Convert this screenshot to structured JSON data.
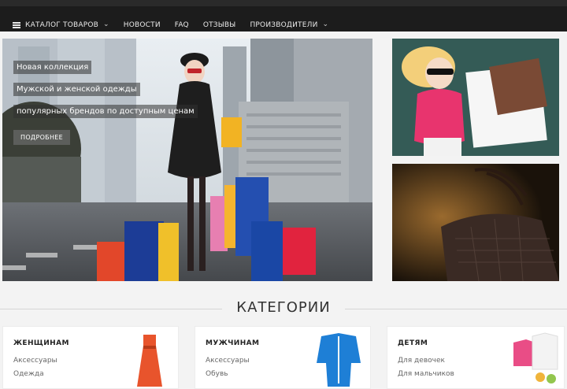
{
  "nav": {
    "items": [
      {
        "label": "КАТАЛОГ ТОВАРОВ",
        "has_dropdown": true,
        "icon": "menu-icon"
      },
      {
        "label": "НОВОСТИ"
      },
      {
        "label": "FAQ"
      },
      {
        "label": "ОТЗЫВЫ"
      },
      {
        "label": "ПРОИЗВОДИТЕЛИ",
        "has_dropdown": true
      }
    ]
  },
  "hero": {
    "line1": "Новая коллекция",
    "line2": "Мужской и женской одежды",
    "line3": "популярных брендов по доступным ценам",
    "button": "ПОДРОБНЕЕ"
  },
  "categories": {
    "title": "КАТЕГОРИИ",
    "cards": [
      {
        "title": "ЖЕНЩИНАМ",
        "links": [
          "Аксессуары",
          "Одежда"
        ]
      },
      {
        "title": "МУЖЧИНАМ",
        "links": [
          "Аксессуары",
          "Обувь"
        ]
      },
      {
        "title": "ДЕТЯМ",
        "links": [
          "Для девочек",
          "Для мальчиков"
        ]
      }
    ]
  },
  "colors": {
    "topbar": "#1c1c1c",
    "accent_dress": "#e8542c",
    "accent_suit": "#1e7fd6"
  }
}
